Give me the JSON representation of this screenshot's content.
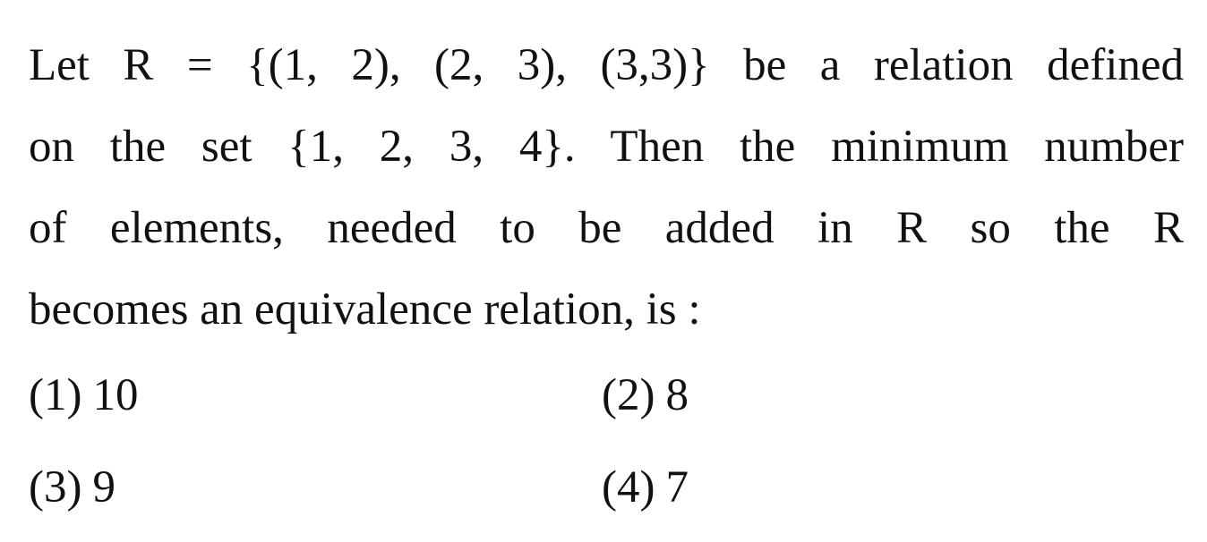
{
  "question": {
    "lines": [
      "Let R = {(1, 2), (2, 3), (3,3)} be a relation defined",
      "on the set {1, 2, 3, 4}. Then the minimum number",
      "of elements, needed to be added in R so the R",
      "becomes an equivalence relation, is :"
    ]
  },
  "options": [
    {
      "number": "(1)",
      "value": "10"
    },
    {
      "number": "(2)",
      "value": "8"
    },
    {
      "number": "(3)",
      "value": "9"
    },
    {
      "number": "(4)",
      "value": "7"
    }
  ]
}
